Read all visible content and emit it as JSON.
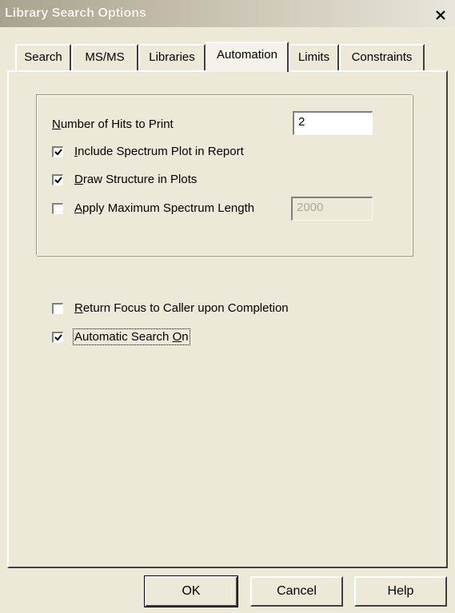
{
  "window": {
    "title": "Library Search Options",
    "close_glyph": "X"
  },
  "tabs": [
    {
      "label": "Search",
      "active": false
    },
    {
      "label": "MS/MS",
      "active": false
    },
    {
      "label": "Libraries",
      "active": false
    },
    {
      "label": "Automation",
      "active": true
    },
    {
      "label": "Limits",
      "active": false
    },
    {
      "label": "Constraints",
      "active": false
    }
  ],
  "group": {
    "hits_label_key": "N",
    "hits_label_rest": "umber of Hits to Print",
    "hits_value": "2",
    "include_plot": {
      "key": "I",
      "rest": "nclude Spectrum Plot in Report",
      "checked": true
    },
    "draw_structure": {
      "key": "D",
      "rest": "raw Structure in Plots",
      "checked": true
    },
    "apply_max": {
      "key": "A",
      "rest": "pply Maximum Spectrum Length",
      "checked": false
    },
    "max_length_value": "2000"
  },
  "options": {
    "return_focus": {
      "key": "R",
      "rest": "eturn Focus to Caller upon Completion",
      "checked": false
    },
    "auto_search": {
      "pre": "Automatic Search ",
      "key": "O",
      "post": "n",
      "checked": true
    }
  },
  "buttons": {
    "ok": "OK",
    "cancel": "Cancel",
    "help": "Help"
  }
}
